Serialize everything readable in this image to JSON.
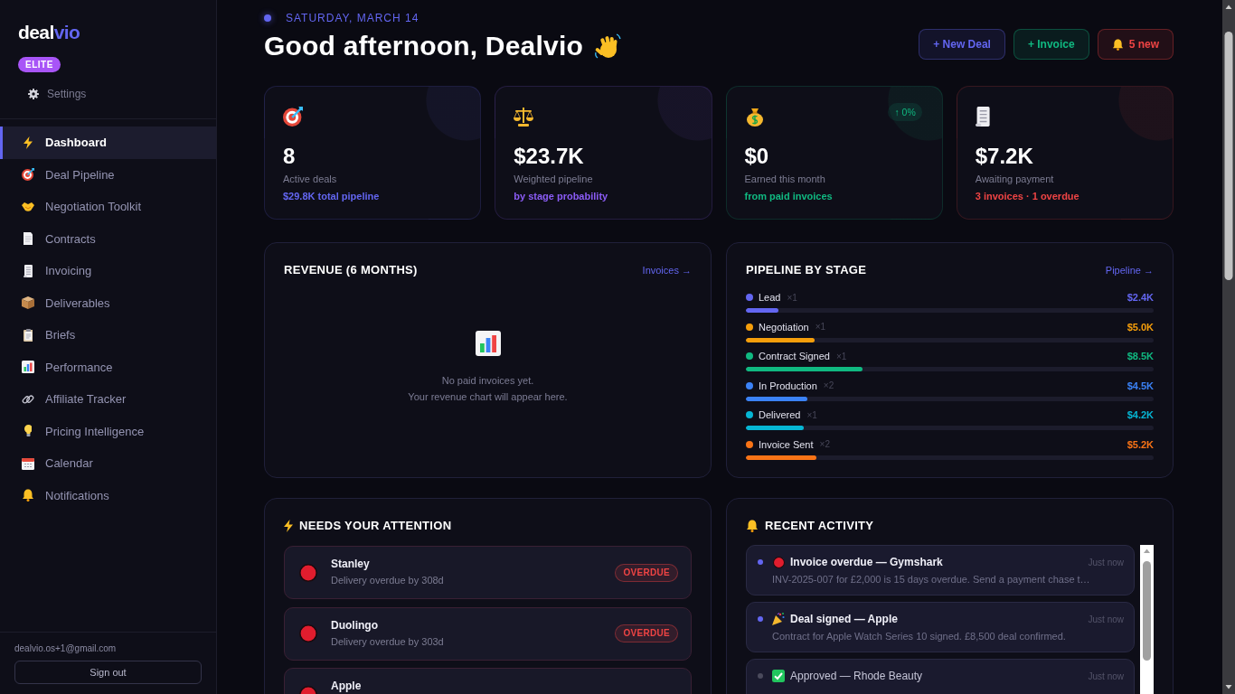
{
  "sidebar": {
    "brand": {
      "name": "deal",
      "accent": "vio"
    },
    "plan_badge": "ELITE",
    "settings_link": "Settings",
    "nav_items": [
      {
        "label": "Dashboard",
        "selected": true
      },
      {
        "label": "Deal Pipeline",
        "selected": false
      },
      {
        "label": "Negotiation Toolkit",
        "selected": false
      },
      {
        "label": "Contracts",
        "selected": false
      },
      {
        "label": "Invoicing",
        "selected": false
      },
      {
        "label": "Deliverables",
        "selected": false
      },
      {
        "label": "Briefs",
        "selected": false
      },
      {
        "label": "Performance",
        "selected": false
      },
      {
        "label": "Affiliate Tracker",
        "selected": false
      },
      {
        "label": "Pricing Intelligence",
        "selected": false
      },
      {
        "label": "Calendar",
        "selected": false
      },
      {
        "label": "Notifications",
        "selected": false
      }
    ],
    "account_email": "dealvio.os+1@gmail.com",
    "sign_out_button": "Sign out"
  },
  "header": {
    "date": "SATURDAY, MARCH 14",
    "greeting": "Good afternoon, Dealvio",
    "buttons": [
      {
        "kind": "add",
        "label": "+ New Deal",
        "color": "#6366f1"
      },
      {
        "kind": "add",
        "label": "+ Invoice",
        "color": "#10b981"
      },
      {
        "kind": "alerts",
        "label": "5 new",
        "color": "#ef4444"
      }
    ]
  },
  "stats": [
    {
      "value": "8",
      "label": "Active deals",
      "note": "$29.8K total pipeline",
      "color": "#6366f1"
    },
    {
      "value": "$23.7K",
      "label": "Weighted pipeline",
      "note": "by stage probability",
      "color": "#8b5cf6"
    },
    {
      "value": "$0",
      "label": "Earned this month",
      "note": "from paid invoices",
      "color": "#10b981",
      "badge": "↑ 0%"
    },
    {
      "value": "$7.2K",
      "label": "Awaiting payment",
      "note": "3 invoices · 1 overdue",
      "color": "#ef4444"
    }
  ],
  "revenue": {
    "title": "REVENUE (6 MONTHS)",
    "link": "Invoices →",
    "empty_lines": [
      "No paid invoices yet.",
      "Your revenue chart will appear here."
    ]
  },
  "pipeline": {
    "title": "PIPELINE BY STAGE",
    "link": "Pipeline →",
    "stages": [
      {
        "name": "Lead",
        "count": "×1",
        "amount": "$2.4K",
        "color": "#6366f1",
        "level": 0.08
      },
      {
        "name": "Negotiation",
        "count": "×1",
        "amount": "$5.0K",
        "color": "#f59e0b",
        "level": 0.168
      },
      {
        "name": "Contract Signed",
        "count": "×1",
        "amount": "$8.5K",
        "color": "#10b981",
        "level": 0.285
      },
      {
        "name": "In Production",
        "count": "×2",
        "amount": "$4.5K",
        "color": "#3b82f6",
        "level": 0.151
      },
      {
        "name": "Delivered",
        "count": "×1",
        "amount": "$4.2K",
        "color": "#06b6d4",
        "level": 0.141
      },
      {
        "name": "Invoice Sent",
        "count": "×2",
        "amount": "$5.2K",
        "color": "#f97316",
        "level": 0.174
      }
    ]
  },
  "attention": {
    "title": "NEEDS YOUR ATTENTION",
    "items": [
      {
        "name": "Stanley",
        "detail": "Delivery overdue by 308d",
        "badge": "OVERDUE"
      },
      {
        "name": "Duolingo",
        "detail": "Delivery overdue by 303d",
        "badge": "OVERDUE"
      },
      {
        "name": "Apple"
      }
    ]
  },
  "activity": {
    "title": "RECENT ACTIVITY",
    "items": [
      {
        "title": "Invoice overdue — Gymshark",
        "time": "Just now",
        "detail": "INV-2025-007 for £2,000 is 15 days overdue. Send a payment chase t…",
        "unread": true
      },
      {
        "title": "Deal signed — Apple",
        "time": "Just now",
        "detail": "Contract for Apple Watch Series 10 signed. £8,500 deal confirmed.",
        "unread": true
      },
      {
        "title": "Approved — Rhode Beauty",
        "time": "Just now",
        "unread": false
      }
    ]
  }
}
